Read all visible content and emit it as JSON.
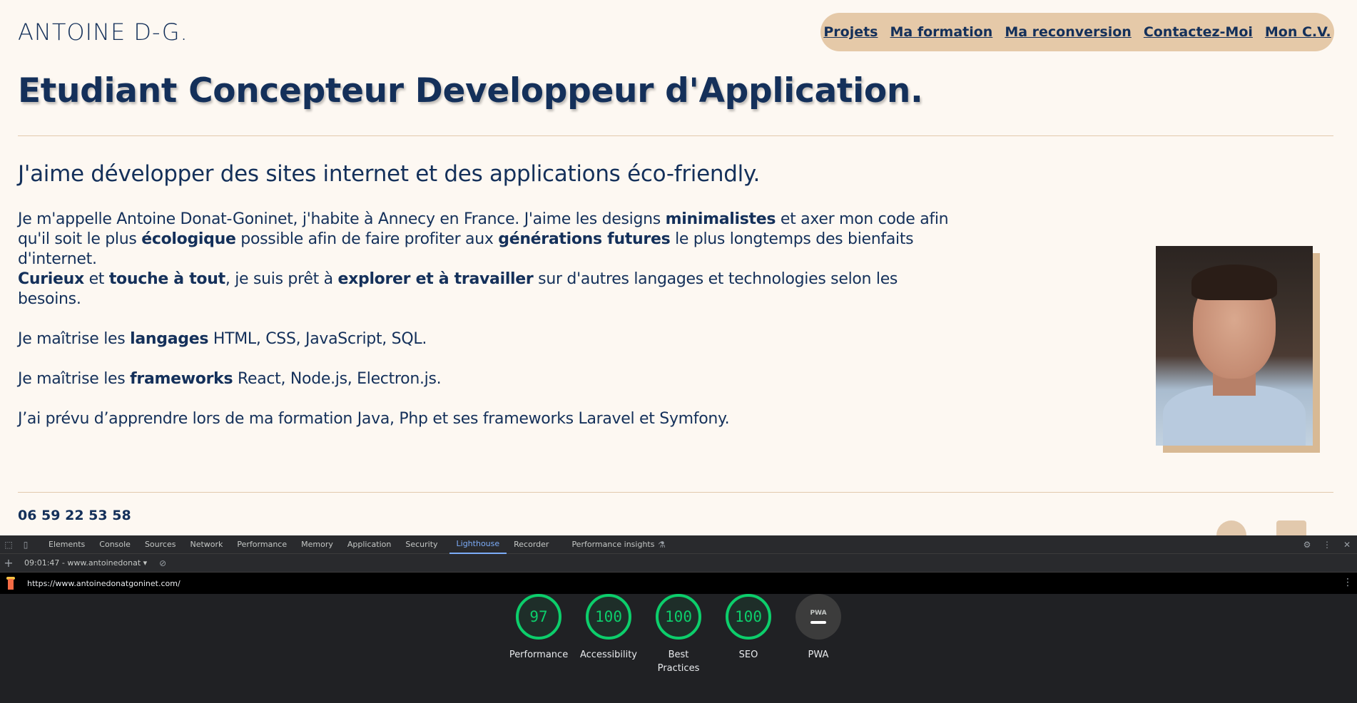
{
  "site": {
    "brand": "ANTOINE D-G.",
    "nav": [
      "Projets",
      "Ma formation",
      "Ma reconversion",
      "Contactez-Moi",
      "Mon C.V."
    ],
    "headline": "Etudiant Concepteur Developpeur d'Application.",
    "subheadline": "J'aime développer des sites internet et des applications éco-friendly.",
    "bio": {
      "p1": {
        "t1": "Je m'appelle Antoine Donat-Goninet, j'habite à Annecy en France. J'aime les designs ",
        "b1": "minimalistes",
        "t2": " et axer mon code afin qu'il soit le plus ",
        "b2": "écologique",
        "t3": " possible afin de faire profiter aux ",
        "b3": "générations futures",
        "t4": " le plus longtemps des bienfaits d'internet."
      },
      "p2": {
        "b1": "Curieux",
        "t1": " et ",
        "b2": "touche à tout",
        "t2": ", je suis prêt à ",
        "b3": "explorer et à travailler",
        "t3": " sur d'autres langages et technologies selon les besoins."
      },
      "p3": {
        "t1": "Je maîtrise les ",
        "b1": "langages",
        "t2": " HTML, CSS, JavaScript, SQL."
      },
      "p4": {
        "t1": "Je maîtrise les ",
        "b1": "frameworks",
        "t2": " React, Node.js, Electron.js."
      },
      "p5": "J’ai prévu d’apprendre lors de ma formation Java, Php et ses frameworks Laravel et Symfony."
    },
    "phone": "06 59 22 53 58",
    "social_icons": [
      "github-icon",
      "linkedin-icon"
    ]
  },
  "devtools": {
    "tabs": [
      "Elements",
      "Console",
      "Sources",
      "Network",
      "Performance",
      "Memory",
      "Application",
      "Security",
      "Lighthouse",
      "Recorder",
      "Performance insights"
    ],
    "active_tab": "Lighthouse",
    "report_selector": "09:01:47 - www.antoinedonat",
    "url": "https://www.antoinedonatgoninet.com/",
    "scores": [
      {
        "label": "Performance",
        "value": "97"
      },
      {
        "label": "Accessibility",
        "value": "100"
      },
      {
        "label": "Best Practices",
        "value": "100"
      },
      {
        "label": "SEO",
        "value": "100"
      },
      {
        "label": "PWA",
        "value": "PWA"
      }
    ],
    "colors": {
      "pass": "#0cce6b",
      "accent": "#7cacf8"
    }
  }
}
